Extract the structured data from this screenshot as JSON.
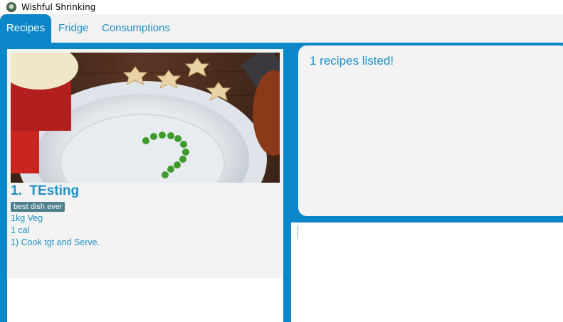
{
  "window": {
    "title": "Wishful Shrinking",
    "icon": "app-logo-icon"
  },
  "tabs": [
    {
      "label": "Recipes",
      "active": true
    },
    {
      "label": "Fridge",
      "active": false
    },
    {
      "label": "Consumptions",
      "active": false
    }
  ],
  "recipe_list": {
    "items": [
      {
        "index_title": "1.  TEsting",
        "tag": "best dish ever",
        "ingredients": "1kg Veg",
        "calories": "1 cal",
        "instructions": "1) Cook tgt and Serve.",
        "image": "food-photo-plate-with-peas"
      }
    ]
  },
  "result_display": {
    "message": "1 recipes listed!"
  },
  "command_box": {
    "value": ""
  },
  "colors": {
    "accent": "#0b86c8",
    "text_blue": "#1f8fc6",
    "panel_bg": "#f3f3f3",
    "tag_bg": "#4e7f8e"
  }
}
